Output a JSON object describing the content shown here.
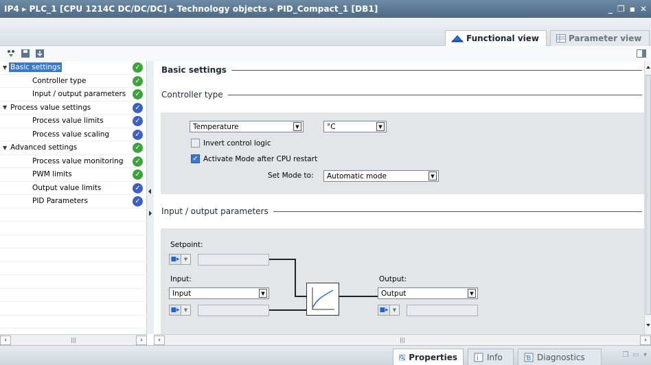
{
  "titlebar": {
    "crumbs": [
      "IP4",
      "PLC_1 [CPU 1214C DC/DC/DC]",
      "Technology objects",
      "PID_Compact_1 [DB1]"
    ],
    "separator": "▸",
    "controls": [
      "_",
      "❐",
      "▪",
      "✕"
    ]
  },
  "view_tabs": [
    {
      "label": "Functional view",
      "icon": "functional-view-icon",
      "active": true
    },
    {
      "label": "Parameter view",
      "icon": "parameter-view-icon",
      "active": false
    }
  ],
  "toolbar": {
    "icons": [
      "connection-icon",
      "save-settings-icon",
      "load-settings-icon"
    ],
    "right_icon": "panel-toggle-icon"
  },
  "nav": {
    "items": [
      {
        "label": "Basic settings",
        "level": 0,
        "expanded": true,
        "selected": true,
        "status": "ok",
        "status_color": "#3aa43a"
      },
      {
        "label": "Controller type",
        "level": 1,
        "status": "ok",
        "status_color": "#3aa43a"
      },
      {
        "label": "Input / output parameters",
        "level": 1,
        "status": "ok",
        "status_color": "#3aa43a"
      },
      {
        "label": "Process value settings",
        "level": 0,
        "expanded": true,
        "status": "default",
        "status_color": "#3d5fc4"
      },
      {
        "label": "Process value limits",
        "level": 1,
        "status": "default",
        "status_color": "#3d5fc4"
      },
      {
        "label": "Process value scaling",
        "level": 1,
        "status": "default",
        "status_color": "#3d5fc4"
      },
      {
        "label": "Advanced settings",
        "level": 0,
        "expanded": true,
        "status": "ok",
        "status_color": "#3aa43a"
      },
      {
        "label": "Process value monitoring",
        "level": 1,
        "status": "ok",
        "status_color": "#3aa43a"
      },
      {
        "label": "PWM limits",
        "level": 1,
        "status": "ok",
        "status_color": "#3aa43a"
      },
      {
        "label": "Output value limits",
        "level": 1,
        "status": "default",
        "status_color": "#3d5fc4"
      },
      {
        "label": "PID Parameters",
        "level": 1,
        "status": "default",
        "status_color": "#3d5fc4"
      }
    ]
  },
  "main": {
    "basic_settings_title": "Basic settings",
    "controller_type_title": "Controller type",
    "controller_type": {
      "type_value": "Temperature",
      "unit_value": "°C",
      "invert_label": "Invert control logic",
      "invert_checked": false,
      "activate_label": "Activate Mode after CPU restart",
      "activate_checked": true,
      "set_mode_label": "Set Mode to:",
      "set_mode_value": "Automatic mode"
    },
    "io_title": "Input / output parameters",
    "io": {
      "setpoint_label": "Setpoint:",
      "input_label": "Input:",
      "input_value": "Input",
      "output_label": "Output:",
      "output_value": "Output"
    }
  },
  "bottom_tabs": [
    {
      "label": "Properties",
      "icon": "properties-icon",
      "active": true
    },
    {
      "label": "Info",
      "icon": "info-icon",
      "active": false
    },
    {
      "label": "Diagnostics",
      "icon": "diagnostics-icon",
      "active": false
    }
  ]
}
